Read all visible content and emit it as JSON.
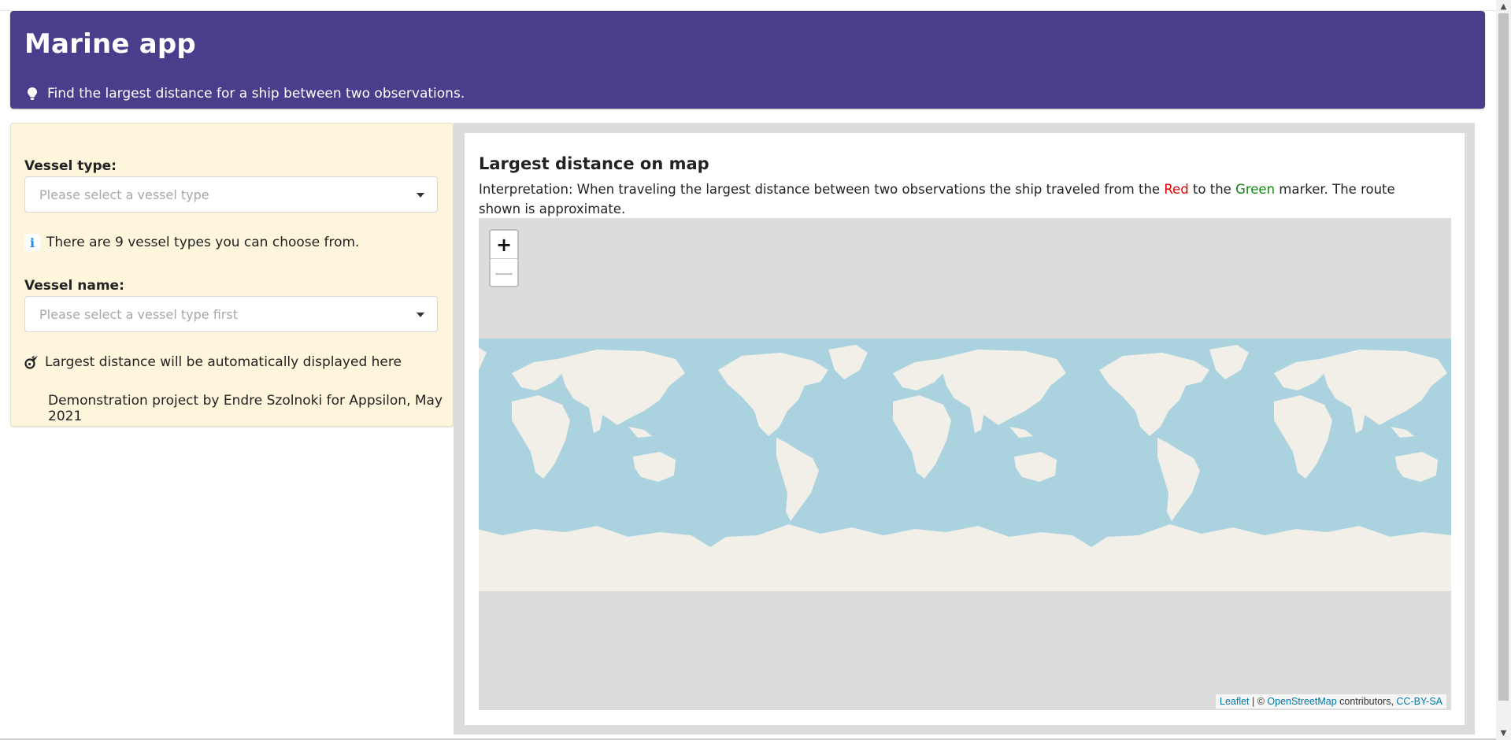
{
  "header": {
    "title": "Marine app",
    "tagline": "Find the largest distance for a ship between two observations."
  },
  "sidebar": {
    "vessel_type_label": "Vessel type:",
    "vessel_type_placeholder": "Please select a vessel type",
    "info_text": "There are 9 vessel types you can choose from.",
    "vessel_name_label": "Vessel name:",
    "vessel_name_placeholder": "Please select a vessel type first",
    "distance_text": "Largest distance will be automatically displayed here",
    "credit": "Demonstration project by Endre Szolnoki for Appsilon, May 2021"
  },
  "panel": {
    "title": "Largest distance on map",
    "interp_prefix": "Interpretation: When traveling the largest distance between two observations the ship traveled from the ",
    "interp_red": "Red",
    "interp_mid": " to the ",
    "interp_green": "Green",
    "interp_suffix": " marker. The route shown is approximate."
  },
  "map": {
    "zoom_in": "+",
    "zoom_out": "—",
    "attribution": {
      "leaflet": "Leaflet",
      "sep": " | © ",
      "osm": "OpenStreetMap",
      "contributors": " contributors, ",
      "license": "CC-BY-SA"
    }
  },
  "colors": {
    "header_bg": "#4a3d8c",
    "sidebar_bg": "#fdf6dc",
    "ocean": "#aad3df",
    "land": "#f2efe9",
    "red_marker": "#e60000",
    "green_marker": "#118811"
  }
}
